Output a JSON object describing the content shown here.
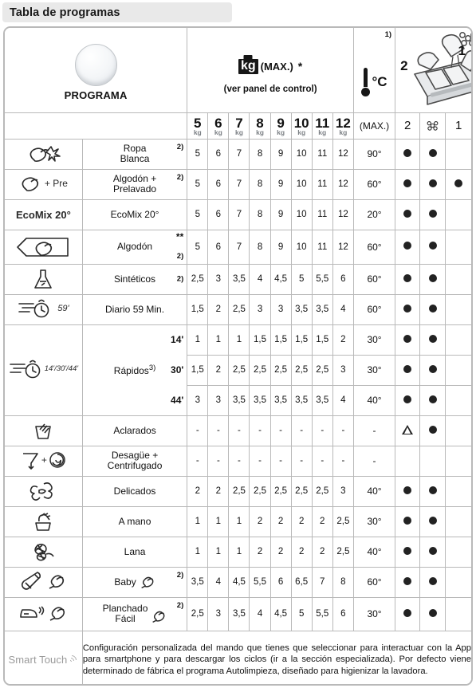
{
  "title": "Tabla de programas",
  "header": {
    "program_label": "PROGRAMA",
    "dial_icon": "program-selector-dial-icon",
    "kg_icon": "kg-weight-icon",
    "kg_max_label": "(MAX.)",
    "kg_star": "*",
    "kg_sub_label": "(ver panel de control)",
    "temp_icon": "thermometer-icon",
    "temp_label": "°C",
    "temp_max_label": "(MAX.)",
    "note_1": "1)",
    "drawer_icon": "detergent-drawer-icon",
    "drawer_num_2": "2",
    "drawer_num_1": "1",
    "capacity_columns": [
      {
        "num": "5",
        "unit": "kg"
      },
      {
        "num": "6",
        "unit": "kg"
      },
      {
        "num": "7",
        "unit": "kg"
      },
      {
        "num": "8",
        "unit": "kg"
      },
      {
        "num": "9",
        "unit": "kg"
      },
      {
        "num": "10",
        "unit": "kg"
      },
      {
        "num": "11",
        "unit": "kg"
      },
      {
        "num": "12",
        "unit": "kg"
      }
    ],
    "drawer_columns": [
      {
        "label": "2",
        "type": "text"
      },
      {
        "label": "",
        "type": "flower-icon"
      },
      {
        "label": "1",
        "type": "text"
      }
    ]
  },
  "rows": [
    {
      "icon": "shirt-stain-icon",
      "icon_text": "",
      "name": "Ropa\nBlanca",
      "sup": "2)",
      "loads": [
        "5",
        "6",
        "7",
        "8",
        "9",
        "10",
        "11",
        "12"
      ],
      "temp": "90°",
      "drawer": [
        "dot",
        "dot",
        ""
      ]
    },
    {
      "icon": "cotton-flower-icon",
      "icon_text": "+ Pre",
      "name": "Algodón +\nPrelavado",
      "sup": "2)",
      "loads": [
        "5",
        "6",
        "7",
        "8",
        "9",
        "10",
        "11",
        "12"
      ],
      "temp": "60°",
      "drawer": [
        "dot",
        "dot",
        "dot"
      ]
    },
    {
      "icon": "ecomix-text-icon",
      "icon_text": "EcoMix 20°",
      "name": "EcoMix 20°",
      "sup": "",
      "loads": [
        "5",
        "6",
        "7",
        "8",
        "9",
        "10",
        "11",
        "12"
      ],
      "temp": "20°",
      "drawer": [
        "dot",
        "dot",
        ""
      ]
    },
    {
      "icon": "cotton-tag-icon",
      "icon_text": "",
      "name": "Algodón",
      "sup": "**",
      "sup2": "2)",
      "loads": [
        "5",
        "6",
        "7",
        "8",
        "9",
        "10",
        "11",
        "12"
      ],
      "temp": "60°",
      "drawer": [
        "dot",
        "dot",
        ""
      ]
    },
    {
      "icon": "flask-synthetic-icon",
      "icon_text": "",
      "name": "Sintéticos",
      "sup": "2)",
      "loads": [
        "2,5",
        "3",
        "3,5",
        "4",
        "4,5",
        "5",
        "5,5",
        "6"
      ],
      "temp": "60°",
      "drawer": [
        "dot",
        "dot",
        ""
      ]
    },
    {
      "icon": "stopwatch-59-icon",
      "icon_text": "59'",
      "name": "Diario 59 Min.",
      "sup": "",
      "loads": [
        "1,5",
        "2",
        "2,5",
        "3",
        "3",
        "3,5",
        "3,5",
        "4"
      ],
      "temp": "60°",
      "drawer": [
        "dot",
        "dot",
        ""
      ]
    }
  ],
  "rapidos": {
    "icon": "stopwatch-rapid-icon",
    "icon_text": "14'/30'/44'",
    "name": "Rápidos",
    "sup": "3)",
    "subrows": [
      {
        "minutes": "14'",
        "loads": [
          "1",
          "1",
          "1",
          "1,5",
          "1,5",
          "1,5",
          "1,5",
          "2"
        ],
        "temp": "30°",
        "drawer": [
          "dot",
          "dot",
          ""
        ]
      },
      {
        "minutes": "30'",
        "loads": [
          "1,5",
          "2",
          "2,5",
          "2,5",
          "2,5",
          "2,5",
          "2,5",
          "3"
        ],
        "temp": "30°",
        "drawer": [
          "dot",
          "dot",
          ""
        ]
      },
      {
        "minutes": "44'",
        "loads": [
          "3",
          "3",
          "3,5",
          "3,5",
          "3,5",
          "3,5",
          "3,5",
          "4"
        ],
        "temp": "40°",
        "drawer": [
          "dot",
          "dot",
          ""
        ]
      }
    ]
  },
  "rows2": [
    {
      "icon": "rinse-basket-icon",
      "icon_text": "",
      "name": "Aclarados",
      "sup": "",
      "loads": [
        "-",
        "-",
        "-",
        "-",
        "-",
        "-",
        "-",
        "-"
      ],
      "temp": "-",
      "drawer": [
        "triangle",
        "dot",
        ""
      ]
    },
    {
      "icon": "drain-spin-icon",
      "icon_text": "",
      "name": "Desagüe +\nCentrifugado",
      "sup": "",
      "loads": [
        "-",
        "-",
        "-",
        "-",
        "-",
        "-",
        "-",
        "-"
      ],
      "temp": "-",
      "drawer": [
        "",
        "",
        ""
      ]
    },
    {
      "icon": "delicates-flower-icon",
      "icon_text": "",
      "name": "Delicados",
      "sup": "",
      "loads": [
        "2",
        "2",
        "2,5",
        "2,5",
        "2,5",
        "2,5",
        "2,5",
        "3"
      ],
      "temp": "40°",
      "drawer": [
        "dot",
        "dot",
        ""
      ]
    },
    {
      "icon": "hand-wash-icon",
      "icon_text": "",
      "name": "A mano",
      "sup": "",
      "loads": [
        "1",
        "1",
        "1",
        "2",
        "2",
        "2",
        "2",
        "2,5"
      ],
      "temp": "30°",
      "drawer": [
        "dot",
        "dot",
        ""
      ]
    },
    {
      "icon": "wool-yarn-icon",
      "icon_text": "",
      "name": "Lana",
      "sup": "",
      "loads": [
        "1",
        "1",
        "1",
        "2",
        "2",
        "2",
        "2",
        "2,5"
      ],
      "temp": "40°",
      "drawer": [
        "dot",
        "dot",
        ""
      ]
    },
    {
      "icon": "baby-bottle-steam-icon",
      "icon_text": "",
      "name": "Baby",
      "name_icon": "steam-puff-icon",
      "sup": "2)",
      "loads": [
        "3,5",
        "4",
        "4,5",
        "5,5",
        "6",
        "6,5",
        "7",
        "8"
      ],
      "temp": "60°",
      "drawer": [
        "dot",
        "dot",
        ""
      ]
    },
    {
      "icon": "iron-steam-icon",
      "icon_text": "",
      "name": "Planchado\nFácil",
      "name_icon": "steam-puff-icon",
      "sup": "2)",
      "loads": [
        "2,5",
        "3",
        "3,5",
        "4",
        "4,5",
        "5",
        "5,5",
        "6"
      ],
      "temp": "30°",
      "drawer": [
        "dot",
        "dot",
        ""
      ]
    }
  ],
  "footer": {
    "brand": "Smart Touch",
    "brand_icon": "wifi-signal-icon",
    "text": "Configuración personalizada del mando que tienes que seleccionar para interactuar con la App para smartphone y para descargar los ciclos (ir a la sección especializada). Por defecto viene determinado de fábrica el programa Autolimpieza, diseñado para higienizar la lavadora."
  }
}
